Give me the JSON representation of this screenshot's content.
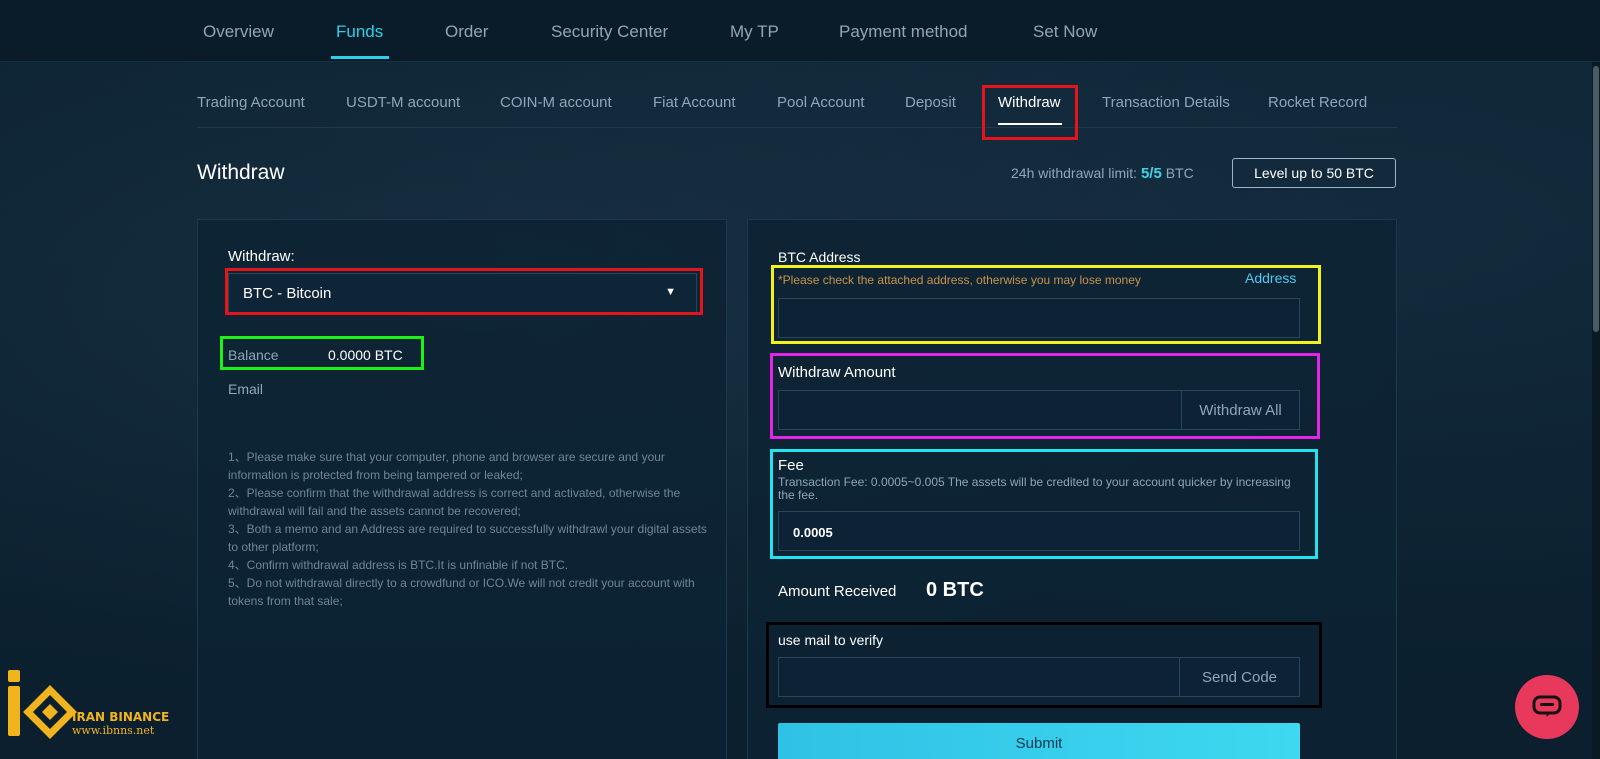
{
  "top_nav": {
    "items": [
      "Overview",
      "Funds",
      "Order",
      "Security Center",
      "My TP",
      "Payment method",
      "Set Now"
    ],
    "active": "Funds"
  },
  "sub_nav": {
    "items": [
      "Trading Account",
      "USDT-M account",
      "COIN-M account",
      "Fiat Account",
      "Pool Account",
      "Deposit",
      "Withdraw",
      "Transaction Details",
      "Rocket Record"
    ],
    "active": "Withdraw"
  },
  "header": {
    "title": "Withdraw",
    "limit_label": "24h withdrawal limit:",
    "limit_used": "5",
    "limit_sep": "/",
    "limit_total": "5",
    "limit_unit": "BTC",
    "level_up_label": "Level up to 50 BTC"
  },
  "left": {
    "withdraw_label": "Withdraw:",
    "coin_selected": "BTC - Bitcoin",
    "balance_label": "Balance",
    "balance_value": "0.0000 BTC",
    "email_label": "Email",
    "notes": [
      "1、Please make sure that your computer, phone and browser are secure and your information is protected from being tampered or leaked;",
      "2、Please confirm that the withdrawal address is correct and activated, otherwise the withdrawal will fail and the assets cannot be recovered;",
      "3、Both a memo and an Address are required to successfully withdrawl your digital assets to other platform;",
      "4、Confirm withdrawal address is BTC.It is unfinable if not BTC.",
      "5、Do not withdrawal directly to a crowdfund or ICO.We will not credit your account with tokens from that sale;"
    ]
  },
  "right": {
    "address_label": "BTC Address",
    "address_warning": "*Please check the attached address, otherwise you may lose money",
    "address_link": "Address",
    "address_value": "",
    "amount_label": "Withdraw Amount",
    "amount_value": "",
    "withdraw_all_label": "Withdraw All",
    "fee_label": "Fee",
    "fee_desc": "Transaction Fee: 0.0005~0.005 The assets will be credited to your account quicker by increasing the fee.",
    "fee_value": "0.0005",
    "received_label": "Amount Received",
    "received_value": "0 BTC",
    "verify_label": "use mail to verify",
    "verify_value": "",
    "send_code_label": "Send Code",
    "submit_label": "Submit"
  },
  "watermark": {
    "name": "IRAN BINANCE",
    "url": "www.ibnns.net"
  },
  "icons": {
    "dropdown": "caret-down-icon",
    "chat": "chat-bubble-icon"
  },
  "colors": {
    "accent": "#2ad1e8",
    "annotation_red": "#e3141b",
    "annotation_green": "#1cf21a",
    "annotation_yellow": "#f4f21b",
    "annotation_magenta": "#e325e7",
    "annotation_cyan": "#23e4ee",
    "annotation_black": "#000000",
    "chat_button": "#e8385b",
    "logo_gold": "#f2b41e"
  }
}
